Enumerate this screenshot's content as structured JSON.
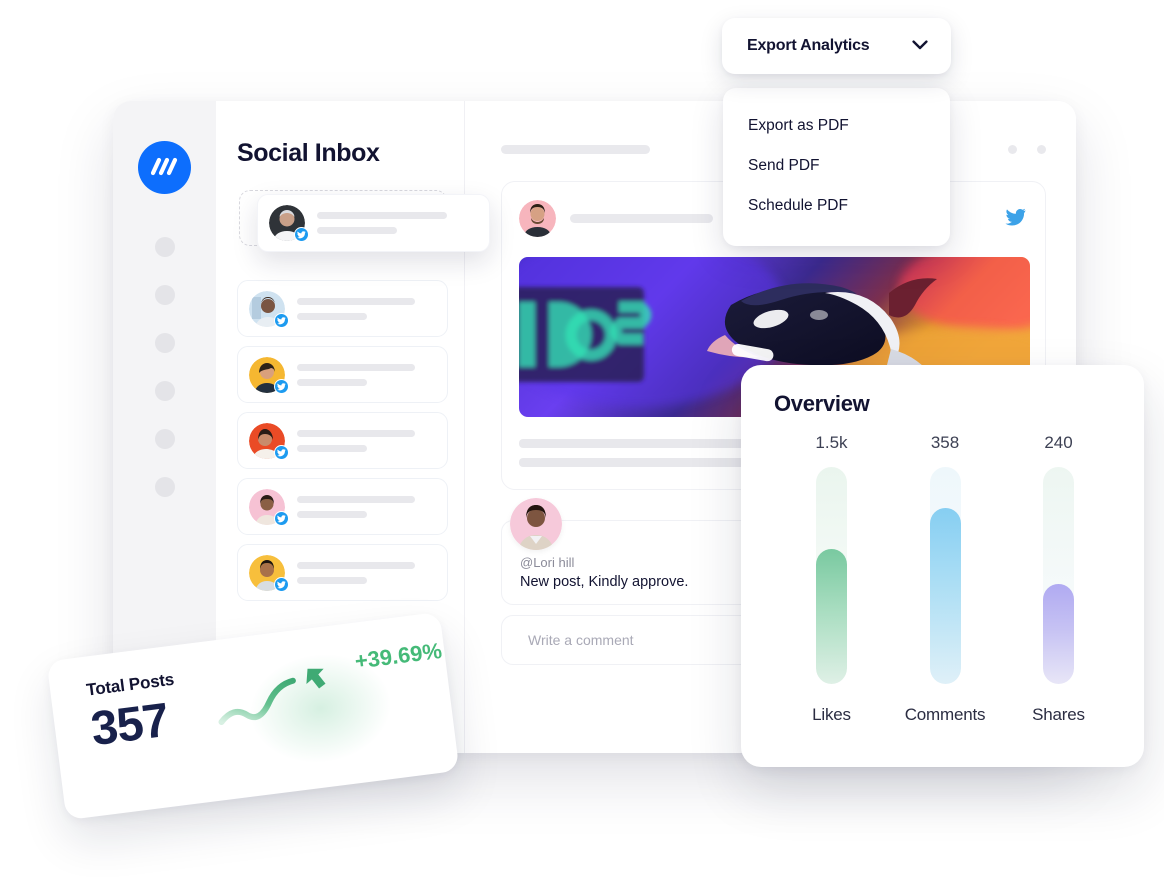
{
  "brand": {
    "logo_name": "wavy-logo",
    "logo_color": "#0d6efd"
  },
  "export": {
    "button_label": "Export Analytics",
    "chevron_icon": "chevron-down-icon",
    "menu_items": [
      {
        "label": "Export as PDF"
      },
      {
        "label": "Send PDF"
      },
      {
        "label": "Schedule PDF"
      }
    ]
  },
  "inbox": {
    "title": "Social Inbox",
    "items": [
      {
        "avatar_bg": "#2f3338",
        "verified_icon": "twitter-verified-icon",
        "dragging": true
      },
      {
        "avatar_bg": "#cfe2f0",
        "verified_icon": "twitter-verified-icon",
        "dragging": false
      },
      {
        "avatar_bg": "#f5b731",
        "verified_icon": "twitter-verified-icon",
        "dragging": false
      },
      {
        "avatar_bg": "#ea4b26",
        "verified_icon": "twitter-verified-icon",
        "dragging": false
      },
      {
        "avatar_bg": "#f6c2d4",
        "verified_icon": "twitter-verified-icon",
        "dragging": false
      },
      {
        "avatar_bg": "#f7bf3c",
        "verified_icon": "twitter-verified-icon",
        "dragging": false
      }
    ]
  },
  "post": {
    "network_icon": "twitter-icon",
    "avatar_bg": "#f7b5bd",
    "image_alt": "vr-headset-neon-photo"
  },
  "comment": {
    "handle": "@Lori hill",
    "text": "New post, Kindly approve.",
    "input_placeholder": "Write a comment",
    "avatar_bg": "#f6c9da"
  },
  "overview": {
    "title": "Overview"
  },
  "total_posts": {
    "label": "Total Posts",
    "value": "357",
    "change": "+39.69%",
    "change_color": "#45ba78",
    "trend_icon": "trend-arrow-up-icon"
  },
  "chart_data": {
    "type": "bar",
    "title": "Overview",
    "categories": [
      "Likes",
      "Comments",
      "Shares"
    ],
    "values": [
      1500,
      358,
      240
    ],
    "value_labels": [
      "1.5k",
      "358",
      "240"
    ],
    "fill_ratios": [
      0.62,
      0.81,
      0.46
    ],
    "series_colors": [
      "#6fc99a",
      "#7ac8f0",
      "#a9a4ef"
    ],
    "track_colors": [
      "#eef7f1",
      "#eef6fb",
      "#f1f0fb"
    ],
    "xlabel": "",
    "ylabel": "",
    "grid": false,
    "legend": "none"
  }
}
